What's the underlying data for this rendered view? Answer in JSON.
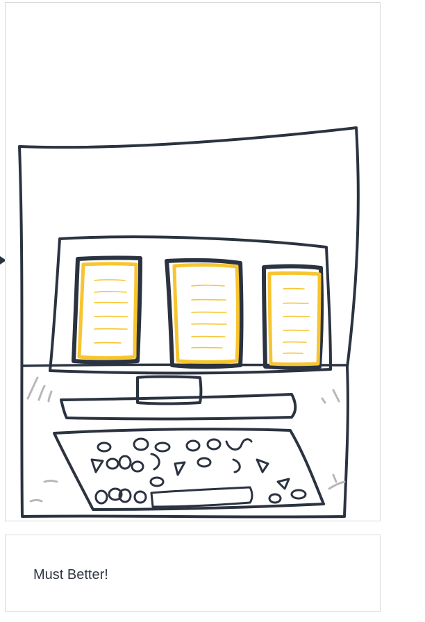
{
  "illustration": {
    "icon": "sketch-computer-with-documents-icon",
    "colors": {
      "ink": "#2b3340",
      "accent": "#f7c531",
      "shadow": "#b8b8b8"
    }
  },
  "caption": {
    "text": "Must Better!"
  }
}
